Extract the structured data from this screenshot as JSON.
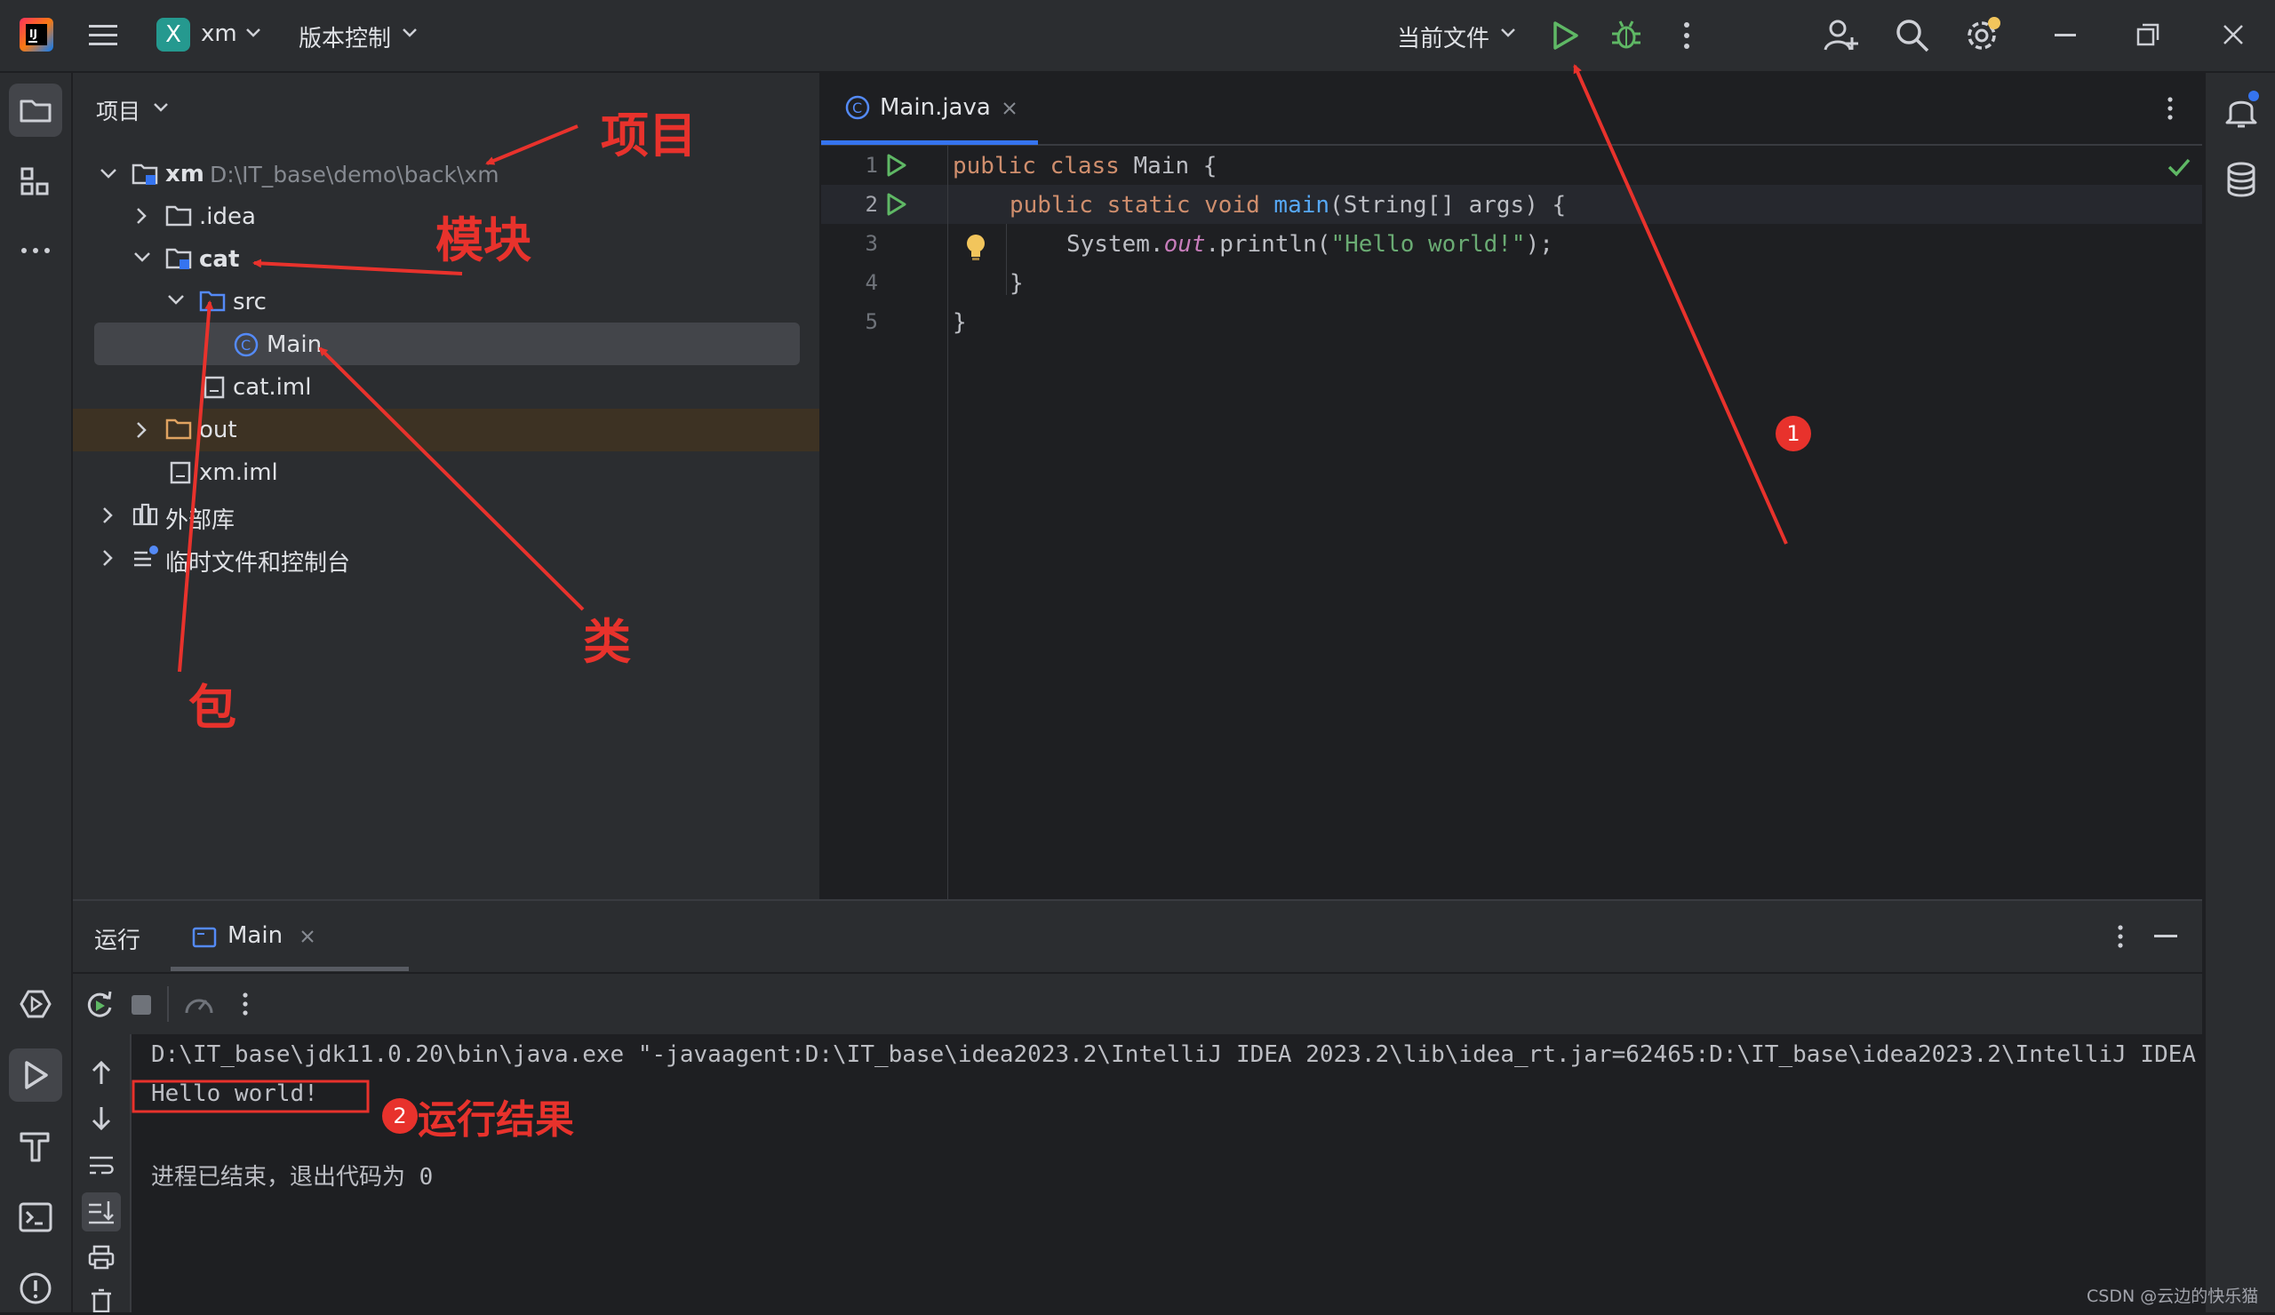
{
  "titlebar": {
    "project_initial": "X",
    "project_name": "xm",
    "vcs_label": "版本控制",
    "run_config": "当前文件",
    "icons": [
      "jetbrains-logo-icon",
      "hamburger-menu-icon",
      "chevron-down-icon",
      "run-icon",
      "debug-icon",
      "more-vertical-icon",
      "add-user-icon",
      "search-icon",
      "settings-icon",
      "minimize-icon",
      "restore-icon",
      "close-icon"
    ]
  },
  "project_panel": {
    "title": "项目",
    "tree": {
      "root_name": "xm",
      "root_path": "D:\\IT_base\\demo\\back\\xm",
      "idea": ".idea",
      "cat": "cat",
      "src": "src",
      "main": "Main",
      "cat_iml": "cat.iml",
      "out": "out",
      "xm_iml": "xm.iml",
      "external_libs": "外部库",
      "scratches": "临时文件和控制台"
    }
  },
  "editor": {
    "tab_label": "Main.java",
    "line_numbers": [
      "1",
      "2",
      "3",
      "4",
      "5"
    ],
    "code": {
      "l1_kw": "public class",
      "l1_rest": " Main {",
      "l2_kw": "public static void",
      "l2_fn": "main",
      "l2_rest": "(String[] args) {",
      "l3_a": "System.",
      "l3_b": "out",
      "l3_c": ".println(",
      "l3_str": "\"Hello world!\"",
      "l3_d": ");",
      "l4": "}",
      "l5": "}"
    }
  },
  "run_panel": {
    "title": "运行",
    "tab_label": "Main",
    "console": {
      "cmd": "D:\\IT_base\\jdk11.0.20\\bin\\java.exe \"-javaagent:D:\\IT_base\\idea2023.2\\IntelliJ IDEA 2023.2\\lib\\idea_rt.jar=62465:D:\\IT_base\\idea2023.2\\IntelliJ IDEA",
      "output": "Hello world!",
      "exit": "进程已结束，退出代码为 0"
    }
  },
  "annotations": {
    "project": "项目",
    "module": "模块",
    "package": "包",
    "class": "类",
    "run_result": "运行结果",
    "badge1": "1",
    "badge2": "2",
    "color": "#e8322c"
  },
  "watermark": "CSDN @云边的快乐猫",
  "colors": {
    "background": "#1e1f22",
    "panel": "#2b2d30",
    "run_green": "#5fb865",
    "accent_blue": "#3574f0"
  }
}
